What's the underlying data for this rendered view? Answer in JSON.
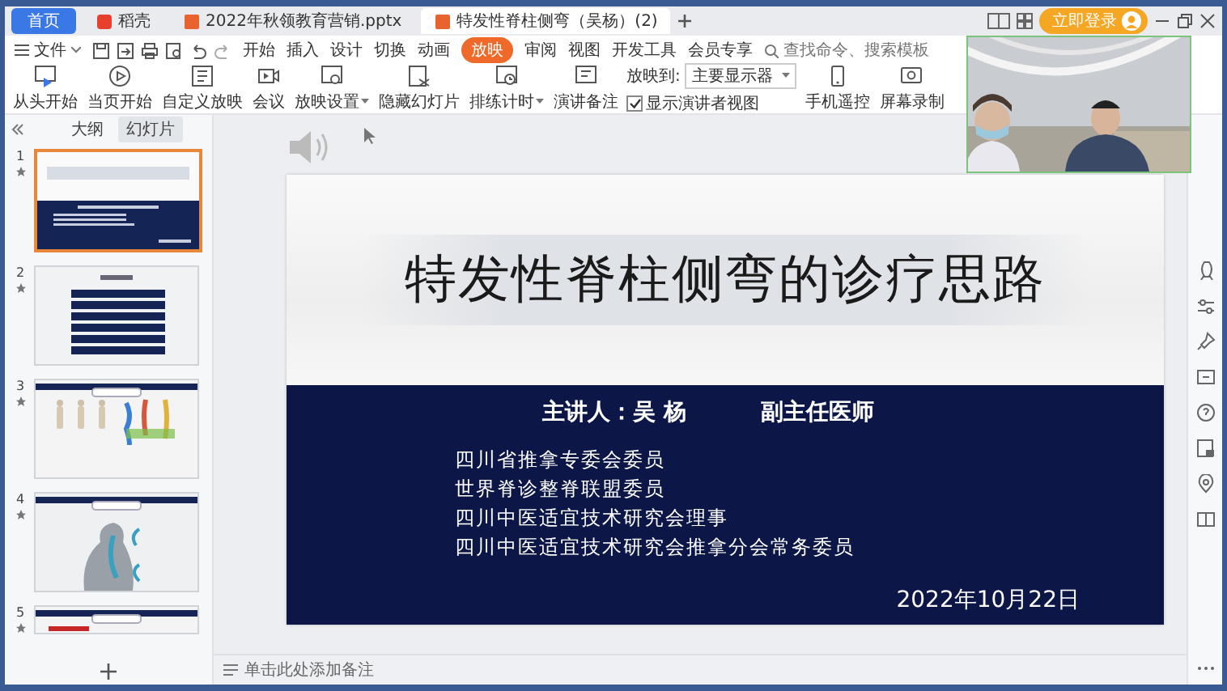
{
  "tabs": [
    {
      "label": "首页",
      "kind": "home",
      "selected": false
    },
    {
      "label": "稻壳",
      "kind": "store",
      "selected": false
    },
    {
      "label": "2022年秋领教育营销.pptx",
      "kind": "doc",
      "selected": false
    },
    {
      "label": "特发性脊柱侧弯（吴杨）(2)",
      "kind": "doc",
      "selected": true
    }
  ],
  "login": "立即登录",
  "menu": {
    "file": "文件",
    "items": [
      {
        "label": "开始",
        "selected": false
      },
      {
        "label": "插入",
        "selected": false
      },
      {
        "label": "设计",
        "selected": false
      },
      {
        "label": "切换",
        "selected": false
      },
      {
        "label": "动画",
        "selected": false
      },
      {
        "label": "放映",
        "selected": true
      },
      {
        "label": "审阅",
        "selected": false
      },
      {
        "label": "视图",
        "selected": false
      },
      {
        "label": "开发工具",
        "selected": false
      },
      {
        "label": "会员专享",
        "selected": false
      }
    ],
    "search": {
      "placeholder": "查找命令、搜索模板"
    }
  },
  "ribbon": {
    "buttons": [
      {
        "label": "从头开始",
        "dropdown": false
      },
      {
        "label": "当页开始",
        "dropdown": false
      },
      {
        "label": "自定义放映",
        "dropdown": false
      },
      {
        "label": "会议",
        "dropdown": false
      },
      {
        "label": "放映设置",
        "dropdown": true
      },
      {
        "label": "隐藏幻灯片",
        "dropdown": false
      },
      {
        "label": "排练计时",
        "dropdown": true
      },
      {
        "label": "演讲备注",
        "dropdown": false
      }
    ],
    "play_to": {
      "label": "放映到:",
      "value": "主要显示器"
    },
    "presenter_view": {
      "label": "显示演讲者视图",
      "checked": true
    },
    "extra_buttons": [
      {
        "label": "手机遥控"
      },
      {
        "label": "屏幕录制"
      }
    ]
  },
  "panel": {
    "tabs": [
      {
        "label": "大纲",
        "selected": false
      },
      {
        "label": "幻灯片",
        "selected": true
      }
    ],
    "slides": [
      {
        "number": "1",
        "kind": "title",
        "selected": true
      },
      {
        "number": "2",
        "kind": "contents",
        "selected": false
      },
      {
        "number": "3",
        "kind": "figures",
        "selected": false
      },
      {
        "number": "4",
        "kind": "anatomy",
        "selected": false
      },
      {
        "number": "5",
        "kind": "partial",
        "selected": false
      }
    ]
  },
  "slide": {
    "title": "特发性脊柱侧弯的诊疗思路",
    "speaker": "主讲人：吴 杨",
    "speaker_title": "副主任医师",
    "roles": [
      "四川省推拿专委会委员",
      "世界脊诊整脊联盟委员",
      "四川中医适宜技术研究会理事",
      "四川中医适宜技术研究会推拿分会常务委员"
    ],
    "date": "2022年10月22日"
  },
  "notes": {
    "placeholder": "单击此处添加备注"
  }
}
